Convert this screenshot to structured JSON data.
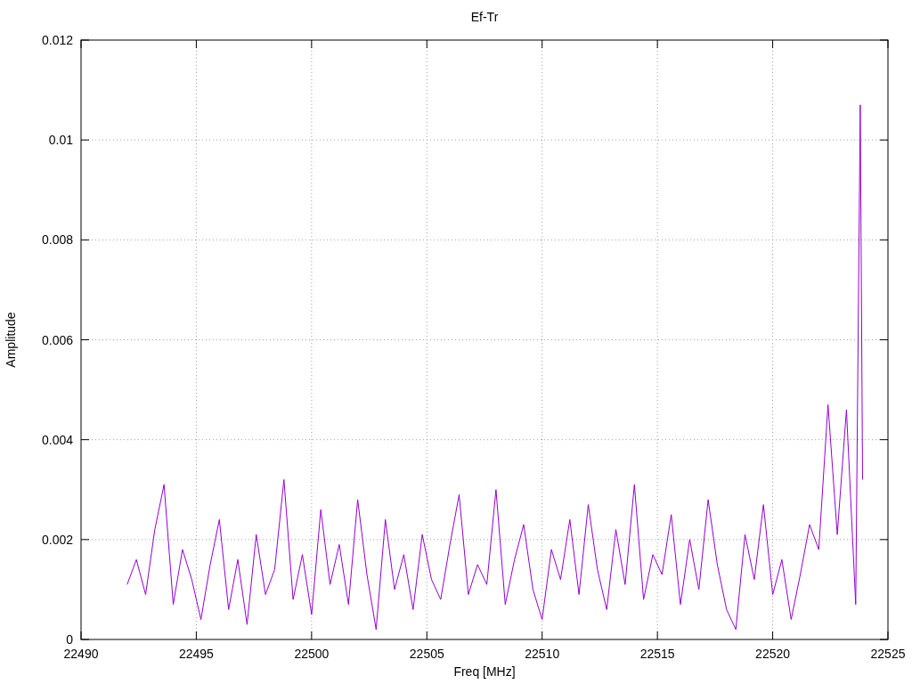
{
  "chart_data": {
    "type": "line",
    "title": "Ef-Tr",
    "xlabel": "Freq [MHz]",
    "ylabel": "Amplitude",
    "xlim": [
      22490,
      22525
    ],
    "ylim": [
      0,
      0.012
    ],
    "xticks": [
      22490,
      22495,
      22500,
      22505,
      22510,
      22515,
      22520,
      22525
    ],
    "yticks": [
      0,
      0.002,
      0.004,
      0.006,
      0.008,
      0.01,
      0.012
    ],
    "x": [
      22492.0,
      22492.4,
      22492.8,
      22493.2,
      22493.6,
      22494.0,
      22494.4,
      22494.8,
      22495.2,
      22495.6,
      22496.0,
      22496.4,
      22496.8,
      22497.2,
      22497.6,
      22498.0,
      22498.4,
      22498.8,
      22499.2,
      22499.6,
      22500.0,
      22500.4,
      22500.8,
      22501.2,
      22501.6,
      22502.0,
      22502.4,
      22502.8,
      22503.2,
      22503.6,
      22504.0,
      22504.4,
      22504.8,
      22505.2,
      22505.6,
      22506.0,
      22506.4,
      22506.8,
      22507.2,
      22507.6,
      22508.0,
      22508.4,
      22508.8,
      22509.2,
      22509.6,
      22510.0,
      22510.4,
      22510.8,
      22511.2,
      22511.6,
      22512.0,
      22512.4,
      22512.8,
      22513.2,
      22513.6,
      22514.0,
      22514.4,
      22514.8,
      22515.2,
      22515.6,
      22516.0,
      22516.4,
      22516.8,
      22517.2,
      22517.6,
      22518.0,
      22518.4,
      22518.8,
      22519.2,
      22519.6,
      22520.0,
      22520.4,
      22520.8,
      22521.2,
      22521.6,
      22522.0,
      22522.4,
      22522.8,
      22523.2,
      22523.6,
      22523.8,
      22523.9
    ],
    "grid": true,
    "series": [
      {
        "color": "#9400d3",
        "values": [
          0.0011,
          0.0016,
          0.0009,
          0.0022,
          0.0031,
          0.0007,
          0.0018,
          0.0012,
          0.0004,
          0.0015,
          0.0024,
          0.0006,
          0.0016,
          0.0003,
          0.0021,
          0.0009,
          0.0014,
          0.0032,
          0.0008,
          0.0017,
          0.0005,
          0.0026,
          0.0011,
          0.0019,
          0.0007,
          0.0028,
          0.0013,
          0.0002,
          0.0024,
          0.001,
          0.0017,
          0.0006,
          0.0021,
          0.0012,
          0.0008,
          0.0019,
          0.0029,
          0.0009,
          0.0015,
          0.0011,
          0.003,
          0.0007,
          0.0016,
          0.0023,
          0.001,
          0.0004,
          0.0018,
          0.0012,
          0.0024,
          0.0009,
          0.0027,
          0.0014,
          0.0006,
          0.0022,
          0.0011,
          0.0031,
          0.0008,
          0.0017,
          0.0013,
          0.0025,
          0.0007,
          0.002,
          0.001,
          0.0028,
          0.0015,
          0.0006,
          0.0002,
          0.0021,
          0.0012,
          0.0027,
          0.0009,
          0.0016,
          0.0004,
          0.0013,
          0.0023,
          0.0018,
          0.0047,
          0.0021,
          0.0046,
          0.0007,
          0.0107,
          0.0032
        ]
      }
    ]
  }
}
